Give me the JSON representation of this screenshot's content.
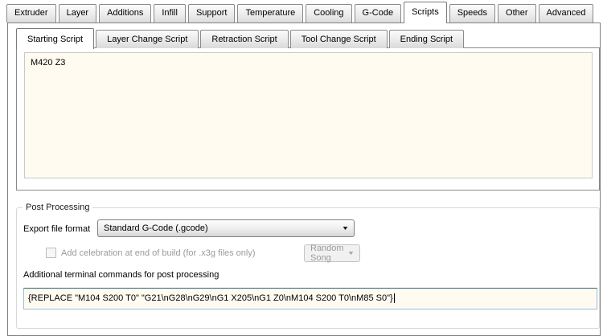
{
  "main_tabs": {
    "labels": [
      "Extruder",
      "Layer",
      "Additions",
      "Infill",
      "Support",
      "Temperature",
      "Cooling",
      "G-Code",
      "Scripts",
      "Speeds",
      "Other",
      "Advanced"
    ],
    "active": "Scripts"
  },
  "script_tabs": {
    "labels": [
      "Starting Script",
      "Layer Change Script",
      "Retraction Script",
      "Tool Change Script",
      "Ending Script"
    ],
    "active": "Starting Script"
  },
  "starting_script": {
    "content": "M420 Z3"
  },
  "post_processing": {
    "title": "Post Processing",
    "export_file_format": {
      "label": "Export file format",
      "value": "Standard G-Code (.gcode)"
    },
    "celebration": {
      "label": "Add celebration at end of build (for .x3g files only)",
      "checked": false,
      "enabled": false,
      "song_value": "Random Song"
    },
    "terminal_commands": {
      "label": "Additional terminal commands for post processing",
      "value": "{REPLACE \"M104 S200 T0\" \"G21\\nG28\\nG29\\nG1 X205\\nG1 Z0\\nM104 S200 T0\\nM85 S0\"}"
    }
  },
  "icons": {
    "dropdown_arrow": "▼"
  },
  "colors": {
    "script_field_bg": "#FFFBF0",
    "focused_border_top": "#33647F",
    "focused_border_side": "#9CBCD3",
    "disabled_text": "#9B9B9B",
    "panel_border": "#7F7F7F",
    "groupbox_border": "#D8D8D8"
  }
}
